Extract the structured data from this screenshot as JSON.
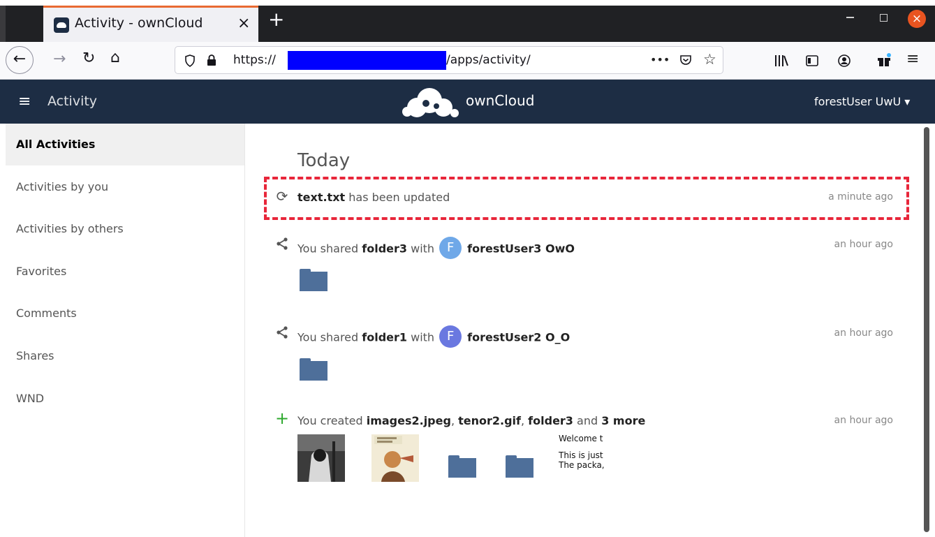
{
  "browser": {
    "tab_title": "Activity - ownCloud",
    "tab_close": "×",
    "new_tab": "+",
    "url_prefix": "https://",
    "url_suffix": "/apps/activity/",
    "page_actions": "•••",
    "win_close": "×"
  },
  "header": {
    "menu_icon": "≡",
    "app_name": "Activity",
    "brand": "ownCloud",
    "user": "forestUser UwU ▾"
  },
  "sidebar": {
    "items": [
      {
        "label": "All Activities"
      },
      {
        "label": "Activities by you"
      },
      {
        "label": "Activities by others"
      },
      {
        "label": "Favorites"
      },
      {
        "label": "Comments"
      },
      {
        "label": "Shares"
      },
      {
        "label": "WND"
      }
    ]
  },
  "main": {
    "section_title": "Today",
    "activities": [
      {
        "icon": "refresh-icon",
        "file": "text.txt",
        "rest": " has been updated",
        "time": "a minute ago"
      },
      {
        "icon": "share-icon",
        "prefix": "You shared ",
        "object": "folder3",
        "middle": " with ",
        "avatar_letter": "F",
        "avatar_color": "#6fa8e8",
        "user": "forestUser3 OwO",
        "time": "an hour ago"
      },
      {
        "icon": "share-icon",
        "prefix": "You shared ",
        "object": "folder1",
        "middle": " with ",
        "avatar_letter": "F",
        "avatar_color": "#6a78e0",
        "user": "forestUser2 O_O",
        "time": "an hour ago"
      },
      {
        "icon": "plus-icon",
        "prefix": "You created ",
        "item1": "images2.jpeg",
        "sep1": ", ",
        "item2": "tenor2.gif",
        "sep2": ", ",
        "item3": "folder3",
        "and": " and ",
        "more": "3 more",
        "time": "an hour ago"
      }
    ],
    "doc_preview": {
      "line1": "Welcome t",
      "line2": "This is just",
      "line3": "The packa,"
    }
  },
  "colors": {
    "header_bg": "#1d2d44",
    "highlight": "#e8263a",
    "folder": "#4e6f9a",
    "plus": "#2ea82e"
  }
}
